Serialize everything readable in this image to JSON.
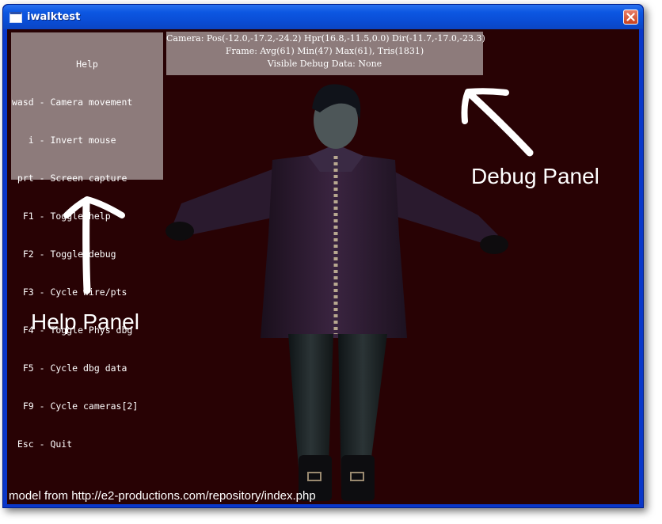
{
  "window": {
    "title": "iwalktest"
  },
  "icons": {
    "app": "window-icon",
    "close": "close-icon"
  },
  "help_panel": {
    "title": "Help",
    "lines": [
      "wasd - Camera movement",
      "   i - Invert mouse",
      " prt - Screen capture",
      "  F1 - Toggle help",
      "  F2 - Toggle debug",
      "  F3 - Cycle wire/pts",
      "  F4 - Toggle Phys dbg",
      "  F5 - Cycle dbg data",
      "  F9 - Cycle cameras[2]",
      " Esc - Quit"
    ]
  },
  "debug_panel": {
    "lines": [
      "Camera: Pos(-12.0,-17.2,-24.2) Hpr(16.8,-11.5,0.0) Dir(-11.7,-17.0,-23.3)",
      "Frame: Avg(61) Min(47) Max(61), Tris(1831)",
      "Visible Debug Data: None"
    ]
  },
  "annotations": {
    "debug_label": "Debug Panel",
    "help_label": "Help Panel"
  },
  "footer": {
    "credit": "model from http://e2-productions.com/repository/index.php"
  },
  "colors": {
    "titlebar": "#0c57e2",
    "viewport_bg": "#280204",
    "panel_bg": "#aa9e9e",
    "close_btn": "#c9411d"
  }
}
